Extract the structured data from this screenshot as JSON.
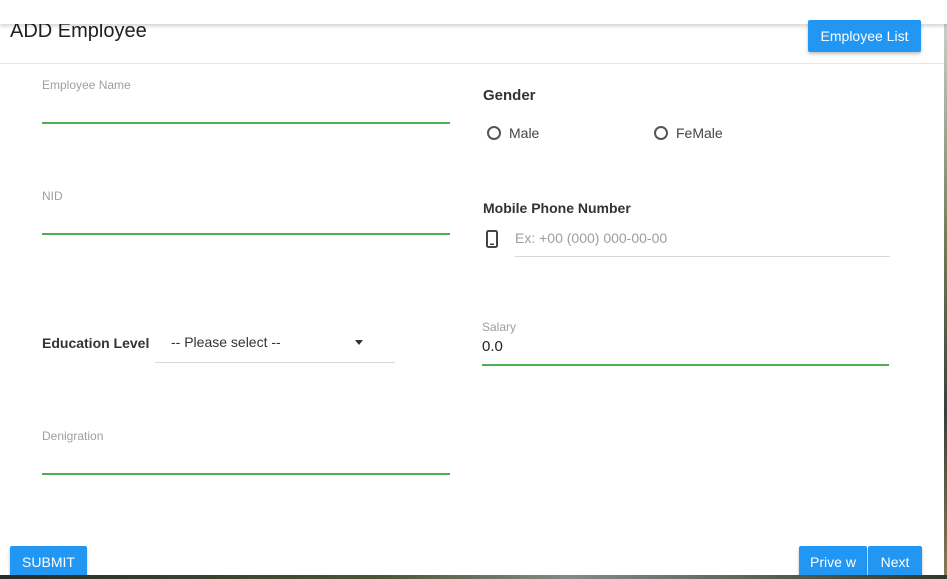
{
  "header": {
    "title": "ADD Employee",
    "employee_list_label": "Employee List"
  },
  "form": {
    "employee_name": {
      "label": "Employee Name",
      "value": ""
    },
    "nid": {
      "label": "NID",
      "value": ""
    },
    "education": {
      "label": "Education Level",
      "selected": "-- Please select --"
    },
    "denigration": {
      "label": "Denigration",
      "value": ""
    },
    "gender": {
      "label": "Gender",
      "options": [
        "Male",
        "FeMale"
      ]
    },
    "mobile": {
      "label": "Mobile Phone Number",
      "placeholder": "Ex: +00 (000) 000-00-00"
    },
    "salary": {
      "label": "Salary",
      "value": "0.0"
    }
  },
  "footer": {
    "submit_label": "SUBMIT",
    "prev_label": "Prive w",
    "next_label": "Next"
  },
  "colors": {
    "primary": "#2196f3",
    "underline_active": "#4caf50"
  },
  "icons": {
    "mobile": "smartphone-icon",
    "select": "caret-down-icon"
  }
}
